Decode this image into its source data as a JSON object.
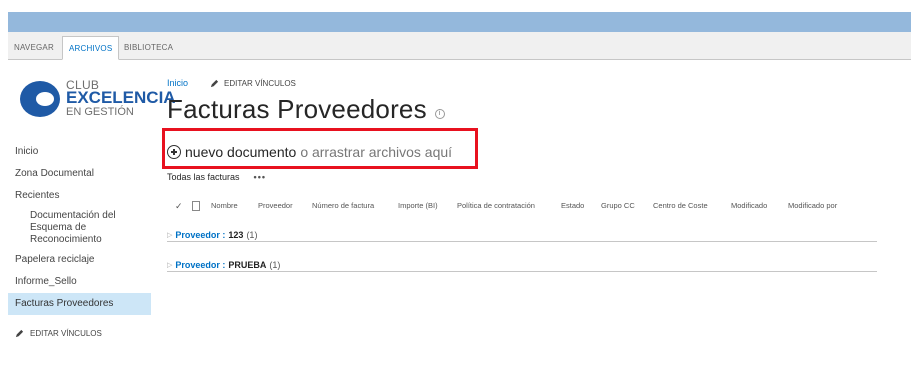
{
  "ribbon": {
    "tabs": [
      {
        "label": "NAVEGAR"
      },
      {
        "label": "ARCHIVOS"
      },
      {
        "label": "BIBLIOTECA"
      }
    ]
  },
  "logo": {
    "line1": "CLUB",
    "line2": "EXCELENCIA",
    "line3": "EN GESTIÓN",
    "colors": {
      "blue": "#1f5aa6",
      "gray": "#6e6e6e"
    }
  },
  "leftnav": {
    "items": [
      {
        "label": "Inicio"
      },
      {
        "label": "Zona Documental"
      },
      {
        "label": "Recientes"
      },
      {
        "label": "Documentación del Esquema de Reconocimiento"
      },
      {
        "label": "Papelera reciclaje"
      },
      {
        "label": "Informe_Sello"
      },
      {
        "label": "Facturas Proveedores"
      }
    ],
    "edit_links": "EDITAR VÍNCULOS"
  },
  "breadcrumb": {
    "home": "Inicio",
    "edit_links": "EDITAR VÍNCULOS"
  },
  "page": {
    "title": "Facturas Proveedores",
    "info_icon": "i"
  },
  "new_document": {
    "action": "nuevo documento",
    "hint": "o arrastrar archivos aquí",
    "highlight_color": "#e8111f"
  },
  "views": {
    "current": "Todas las facturas",
    "more": "•••"
  },
  "columns": [
    "Nombre",
    "Proveedor",
    "Número de factura",
    "Importe (BI)",
    "Política de contratación",
    "Estado",
    "Grupo CC",
    "Centro de Coste",
    "Modificado",
    "Modificado por"
  ],
  "groups": [
    {
      "name": "Proveedor :",
      "value": "123",
      "count": "(1)"
    },
    {
      "name": "Proveedor :",
      "value": "PRUEBA",
      "count": "(1)"
    }
  ],
  "colors": {
    "accent": "#0072c6",
    "topbar": "#94b8dc",
    "selected_nav": "#cde6f7"
  }
}
